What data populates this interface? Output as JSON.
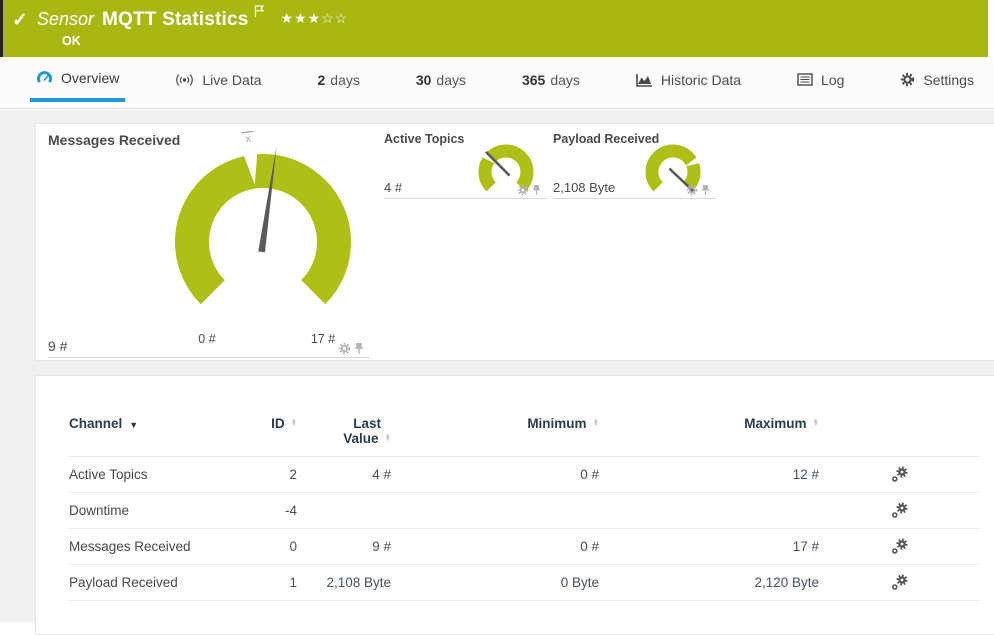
{
  "colors": {
    "status_ok_green": "#a8b712",
    "gauge_green": "#aebf17",
    "active_tab_blue": "#1b9ad6"
  },
  "header": {
    "kind_label": "Sensor",
    "title": "MQTT Statistics",
    "status": "OK",
    "stars_filled": "★★★",
    "stars_empty": "☆☆"
  },
  "tabs": [
    {
      "label": "Overview",
      "icon": "gauge-icon",
      "active": true
    },
    {
      "label": "Live Data",
      "icon": "broadcast-icon"
    },
    {
      "number": "2",
      "label": "days"
    },
    {
      "number": "30",
      "label": "days"
    },
    {
      "number": "365",
      "label": "days"
    },
    {
      "label": "Historic Data",
      "icon": "chart-icon"
    },
    {
      "label": "Log",
      "icon": "log-icon"
    },
    {
      "label": "Settings",
      "icon": "gear-icon"
    }
  ],
  "gauges": {
    "primary": {
      "title": "Messages Received",
      "value": "9 #",
      "value_num": 9,
      "min": 0,
      "max": 17,
      "scale_min_label": "0 #",
      "scale_max_label": "17 #",
      "avg_fraction": 0.47,
      "avg_marker_label": "x"
    },
    "mini": [
      {
        "title": "Active Topics",
        "value": "4 #",
        "value_num": 4,
        "min": 0,
        "max": 12,
        "avg_fraction": 0.31
      },
      {
        "title": "Payload Received",
        "value": "2,108 Byte",
        "value_num": 2108,
        "min": 0,
        "max": 2120,
        "avg_fraction": 0.74
      }
    ]
  },
  "table": {
    "head": {
      "channel": "Channel",
      "id": "ID",
      "last1": "Last",
      "last2": "Value",
      "minimum": "Minimum",
      "maximum": "Maximum"
    },
    "rows": [
      {
        "channel": "Active Topics",
        "id": "2",
        "last": "4 #",
        "min": "0 #",
        "max": "12 #"
      },
      {
        "channel": "Downtime",
        "id": "-4",
        "last": "",
        "min": "",
        "max": ""
      },
      {
        "channel": "Messages Received",
        "id": "0",
        "last": "9 #",
        "min": "0 #",
        "max": "17 #"
      },
      {
        "channel": "Payload Received",
        "id": "1",
        "last": "2,108 Byte",
        "min": "0 Byte",
        "max": "2,120 Byte"
      }
    ]
  }
}
